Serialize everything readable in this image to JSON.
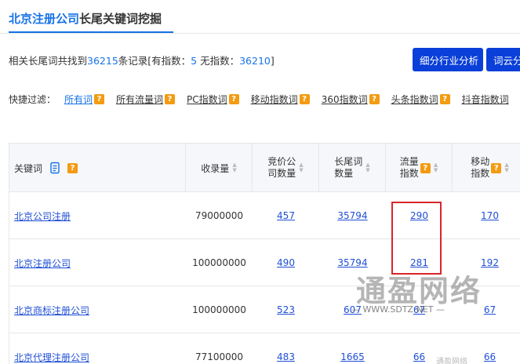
{
  "header": {
    "title_highlight": "北京注册公司",
    "title_rest": "长尾关键词挖掘"
  },
  "summary": {
    "prefix": "相关长尾词共找到",
    "total": "36215",
    "mid1": "条记录[有指数：",
    "with_index": "5",
    "mid2": " 无指数：",
    "without_index": "36210",
    "suffix": "]"
  },
  "buttons": {
    "analysis": "细分行业分析",
    "cloud": "词云分析"
  },
  "filters": {
    "label": "快捷过滤：",
    "items": [
      "所有词",
      "所有流量词",
      "PC指数词",
      "移动指数词",
      "360指数词",
      "头条指数词",
      "抖音指数词"
    ]
  },
  "table": {
    "headers": {
      "keyword": "关键词",
      "collect": "收录量",
      "bid_1": "竞价公",
      "bid_2": "司数量",
      "long_1": "长尾词",
      "long_2": "数量",
      "traffic_1": "流量",
      "traffic_2": "指数",
      "mobile_1": "移动",
      "mobile_2": "指数"
    },
    "rows": [
      {
        "keyword": "北京公司注册",
        "collect": "79000000",
        "bid": "457",
        "longtail": "35794",
        "traffic": "290",
        "mobile": "170"
      },
      {
        "keyword": "北京注册公司",
        "collect": "100000000",
        "bid": "490",
        "longtail": "35794",
        "traffic": "281",
        "mobile": "192"
      },
      {
        "keyword": "北京商标注册公司",
        "collect": "100000000",
        "bid": "523",
        "longtail": "607",
        "traffic": "67",
        "mobile": "67"
      },
      {
        "keyword": "北京代理注册公司",
        "collect": "77100000",
        "bid": "483",
        "longtail": "1665",
        "traffic": "66",
        "mobile": "66"
      }
    ]
  },
  "watermark": {
    "big": "通盈网络",
    "small": "— WWW.SDTZ.NET —",
    "bottom": "通盈网络"
  },
  "icons": {
    "qbadge": "?",
    "doc": "document-icon"
  },
  "colors": {
    "accent": "#1673e6",
    "button": "#0a3fd9",
    "badge": "#f39b12",
    "highlight_box": "#d9252a"
  }
}
